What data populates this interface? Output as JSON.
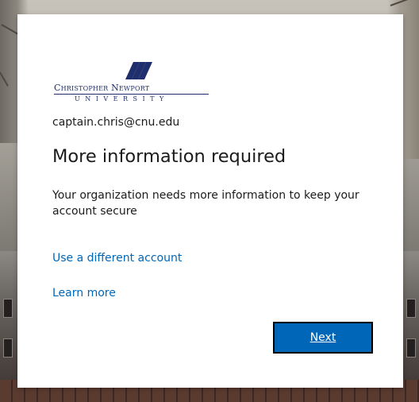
{
  "background": {
    "description_colors": {
      "sky": "#c7c3bb",
      "building": "#4e4744",
      "brick": "#5a3b30"
    }
  },
  "logo": {
    "line1": "Christopher Newport",
    "line2": "UNIVERSITY",
    "color": "#1f2f6e",
    "icon": "cnu-logo-mark-icon"
  },
  "account": {
    "email": "captain.chris@cnu.edu"
  },
  "main": {
    "title": "More information required",
    "description": "Your organization needs more information to keep your account secure"
  },
  "links": {
    "different_account": "Use a different account",
    "learn_more": "Learn more",
    "color": "#0067b8"
  },
  "actions": {
    "next_label": "Next",
    "next_color": "#0067b8"
  }
}
